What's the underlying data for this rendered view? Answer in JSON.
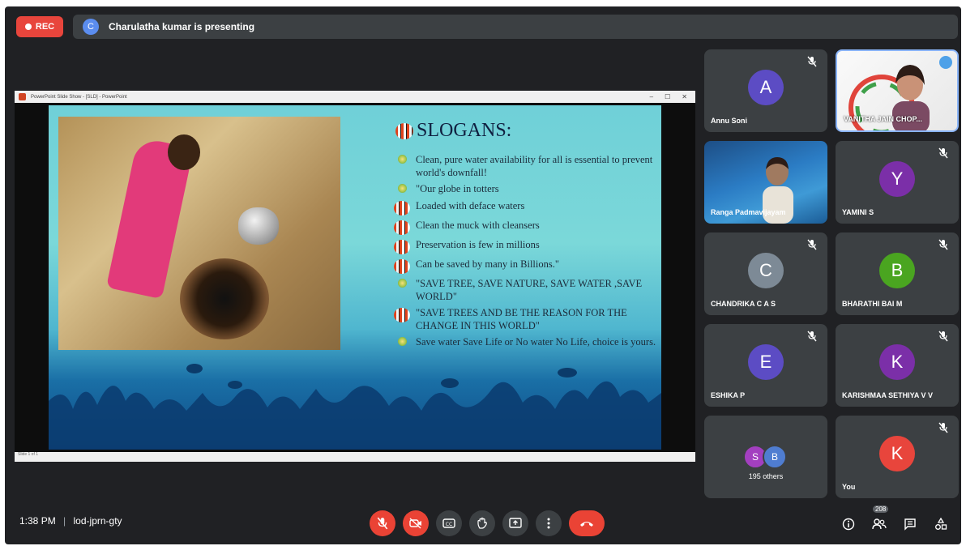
{
  "top_bar": {
    "rec_label": "REC",
    "presenter_initial": "C",
    "presenting_text": "Charulatha kumar is presenting"
  },
  "shared_window": {
    "title": "PowerPoint Slide Show - [SLD] - PowerPoint",
    "status": "Slide 1 of 1",
    "slide": {
      "title": "SLOGANS:",
      "items": [
        {
          "bullet": "leaf",
          "text": "Clean, pure water availability for all is essential to prevent world's downfall!"
        },
        {
          "bullet": "leaf",
          "text": "\"Our globe in totters"
        },
        {
          "bullet": "fish",
          "text": "Loaded with deface waters"
        },
        {
          "bullet": "fish",
          "text": "Clean the muck with cleansers"
        },
        {
          "bullet": "fish",
          "text": "Preservation is few in millions"
        },
        {
          "bullet": "fish",
          "text": "Can be saved by many in Billions.\""
        },
        {
          "bullet": "leaf",
          "text": "\"SAVE TREE, SAVE NATURE, SAVE WATER ,SAVE WORLD\""
        },
        {
          "bullet": "fish",
          "text": "\"SAVE TREES AND BE THE REASON FOR THE CHANGE IN THIS WORLD\""
        },
        {
          "bullet": "leaf",
          "text": "Save water Save Life or No water No Life, choice is yours."
        }
      ]
    }
  },
  "participants": [
    {
      "name": "Annu Soni",
      "initial": "A",
      "color": "#5c4cc4",
      "muted": true,
      "video": false
    },
    {
      "name": "VANITHA JAIN CHOP...",
      "initial": "",
      "color": "",
      "muted": false,
      "video": true
    },
    {
      "name": "Ranga Padmavijayam",
      "initial": "",
      "color": "",
      "muted": false,
      "video": true
    },
    {
      "name": "YAMINI S",
      "initial": "Y",
      "color": "#7b2fa8",
      "muted": true,
      "video": false
    },
    {
      "name": "CHANDRIKA C A S",
      "initial": "C",
      "color": "#7d8a96",
      "muted": true,
      "video": false
    },
    {
      "name": "BHARATHI BAI M",
      "initial": "B",
      "color": "#4aa520",
      "muted": true,
      "video": false
    },
    {
      "name": "ESHIKA P",
      "initial": "E",
      "color": "#5c4cc4",
      "muted": true,
      "video": false
    },
    {
      "name": "KARISHMAA SETHIYA V V",
      "initial": "K",
      "color": "#7b2fa8",
      "muted": true,
      "video": false
    },
    {
      "name": "195 others",
      "initial": "",
      "color": "",
      "muted": false,
      "video": false,
      "others": [
        "S",
        "B"
      ],
      "others_colors": [
        "#a33fc0",
        "#4f7dd1"
      ]
    },
    {
      "name": "You",
      "initial": "K",
      "color": "#e8453c",
      "muted": true,
      "video": false
    }
  ],
  "bottom_bar": {
    "time": "1:38 PM",
    "separator": "|",
    "meeting_code": "lod-jprn-gty",
    "participant_count": "208"
  },
  "colors": {
    "background": "#202124",
    "tile": "#3c4043",
    "danger": "#ea4335",
    "accent": "#8ab4f8"
  }
}
